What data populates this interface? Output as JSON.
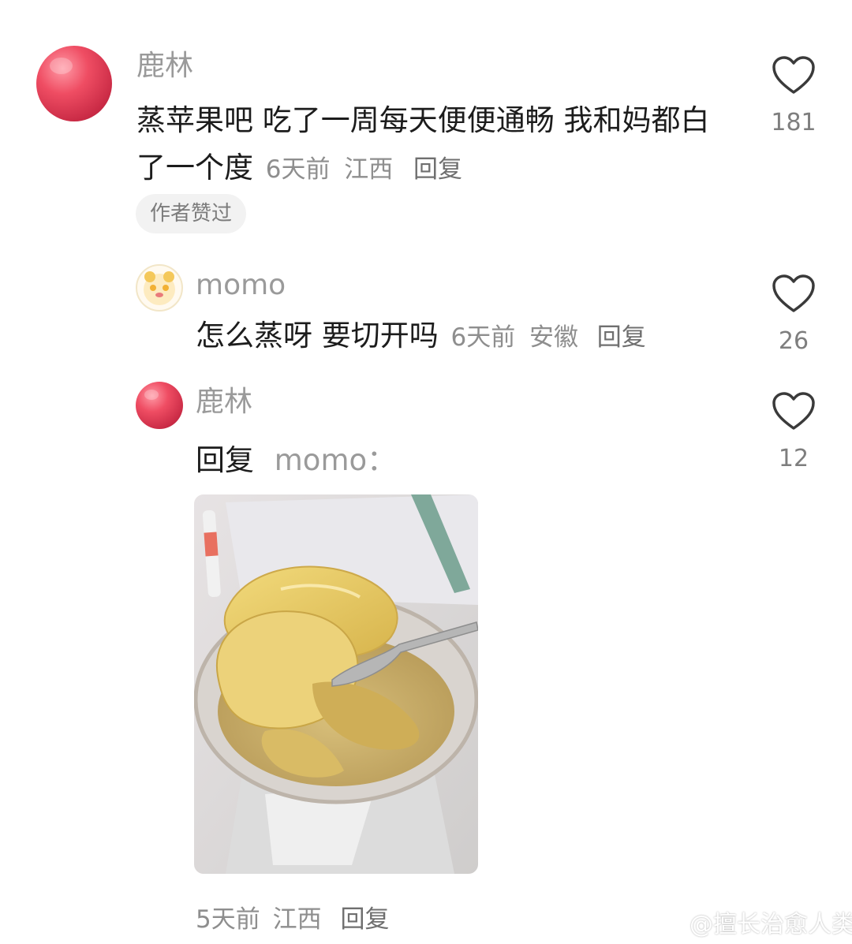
{
  "comments": [
    {
      "username": "鹿林",
      "text": "蒸苹果吧 吃了一周每天便便通畅 我和妈都白了一个度",
      "time": "6天前",
      "location": "江西",
      "reply_label": "回复",
      "likes": "181",
      "badge": "作者赞过"
    }
  ],
  "replies": [
    {
      "username": "momo",
      "text": "怎么蒸呀 要切开吗",
      "time": "6天前",
      "location": "安徽",
      "reply_label": "回复",
      "likes": "26"
    },
    {
      "username": "鹿林",
      "reply_prefix": "回复",
      "reply_target": "momo：",
      "time": "5天前",
      "location": "江西",
      "reply_label": "回复",
      "likes": "12"
    }
  ],
  "watermark": "@擅长治愈人类",
  "icons": {
    "like": "heart-outline-icon",
    "watermark": "weibo-icon"
  },
  "colors": {
    "username": "#9a9a9a",
    "text": "#1c1c1c",
    "meta": "#8e8e8e",
    "badge_bg": "#f2f2f2"
  }
}
